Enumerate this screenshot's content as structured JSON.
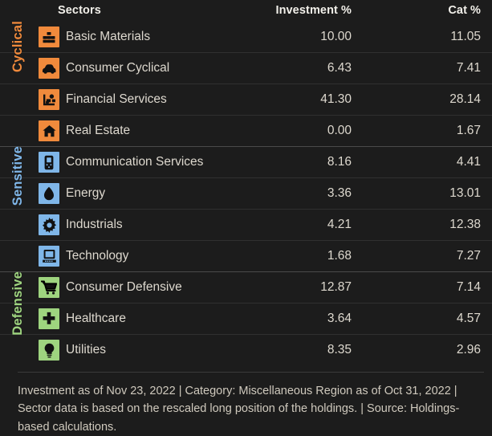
{
  "header": {
    "sectors_label": "Sectors",
    "investment_label": "Investment",
    "investment_pct": "%",
    "cat_label": "Cat",
    "cat_pct": "%"
  },
  "colors": {
    "background": "#1c1c1c",
    "cyclical": "#f08a3c",
    "sensitive": "#7fb6e8",
    "defensive": "#9ed47f",
    "text": "#ded9cf",
    "header_text": "#f2f0ea",
    "rule": "#303030",
    "group_rule": "#4a4a4a"
  },
  "groups": [
    {
      "label": "Cyclical",
      "color": "#f08a3c",
      "start": 0,
      "count": 4
    },
    {
      "label": "Sensitive",
      "color": "#7fb6e8",
      "start": 4,
      "count": 4
    },
    {
      "label": "Defensive",
      "color": "#9ed47f",
      "start": 8,
      "count": 3
    }
  ],
  "rows": [
    {
      "icon": "basic-materials-icon",
      "name": "Basic Materials",
      "investment": "10.00",
      "cat": "11.05",
      "group": 0
    },
    {
      "icon": "consumer-cyclical-icon",
      "name": "Consumer Cyclical",
      "investment": "6.43",
      "cat": "7.41",
      "group": 0
    },
    {
      "icon": "financial-services-icon",
      "name": "Financial Services",
      "investment": "41.30",
      "cat": "28.14",
      "group": 0
    },
    {
      "icon": "real-estate-icon",
      "name": "Real Estate",
      "investment": "0.00",
      "cat": "1.67",
      "group": 0
    },
    {
      "icon": "communication-services-icon",
      "name": "Communication Services",
      "investment": "8.16",
      "cat": "4.41",
      "group": 1
    },
    {
      "icon": "energy-icon",
      "name": "Energy",
      "investment": "3.36",
      "cat": "13.01",
      "group": 1
    },
    {
      "icon": "industrials-icon",
      "name": "Industrials",
      "investment": "4.21",
      "cat": "12.38",
      "group": 1
    },
    {
      "icon": "technology-icon",
      "name": "Technology",
      "investment": "1.68",
      "cat": "7.27",
      "group": 1
    },
    {
      "icon": "consumer-defensive-icon",
      "name": "Consumer Defensive",
      "investment": "12.87",
      "cat": "7.14",
      "group": 2
    },
    {
      "icon": "healthcare-icon",
      "name": "Healthcare",
      "investment": "3.64",
      "cat": "4.57",
      "group": 2
    },
    {
      "icon": "utilities-icon",
      "name": "Utilities",
      "investment": "8.35",
      "cat": "2.96",
      "group": 2
    }
  ],
  "footer": {
    "text": "Investment as of Nov 23, 2022 | Category: Miscellaneous Region as of Oct 31, 2022 | Sector data is based on the rescaled long position of the holdings. | Source: Holdings-based calculations."
  },
  "chart_data": {
    "type": "table",
    "title": "Sectors",
    "columns": [
      "Sectors",
      "Investment %",
      "Cat %"
    ],
    "categories": [
      "Basic Materials",
      "Consumer Cyclical",
      "Financial Services",
      "Real Estate",
      "Communication Services",
      "Energy",
      "Industrials",
      "Technology",
      "Consumer Defensive",
      "Healthcare",
      "Utilities"
    ],
    "series": [
      {
        "name": "Investment %",
        "values": [
          10.0,
          6.43,
          41.3,
          0.0,
          8.16,
          3.36,
          4.21,
          1.68,
          12.87,
          3.64,
          8.35
        ]
      },
      {
        "name": "Cat %",
        "values": [
          11.05,
          7.41,
          28.14,
          1.67,
          4.41,
          13.01,
          12.38,
          7.27,
          7.14,
          4.57,
          2.96
        ]
      }
    ],
    "groupings": [
      {
        "name": "Cyclical",
        "members": [
          "Basic Materials",
          "Consumer Cyclical",
          "Financial Services",
          "Real Estate"
        ]
      },
      {
        "name": "Sensitive",
        "members": [
          "Communication Services",
          "Energy",
          "Industrials",
          "Technology"
        ]
      },
      {
        "name": "Defensive",
        "members": [
          "Consumer Defensive",
          "Healthcare",
          "Utilities"
        ]
      }
    ],
    "xlabel": "",
    "ylabel": "",
    "grid": false,
    "legend": "none"
  }
}
